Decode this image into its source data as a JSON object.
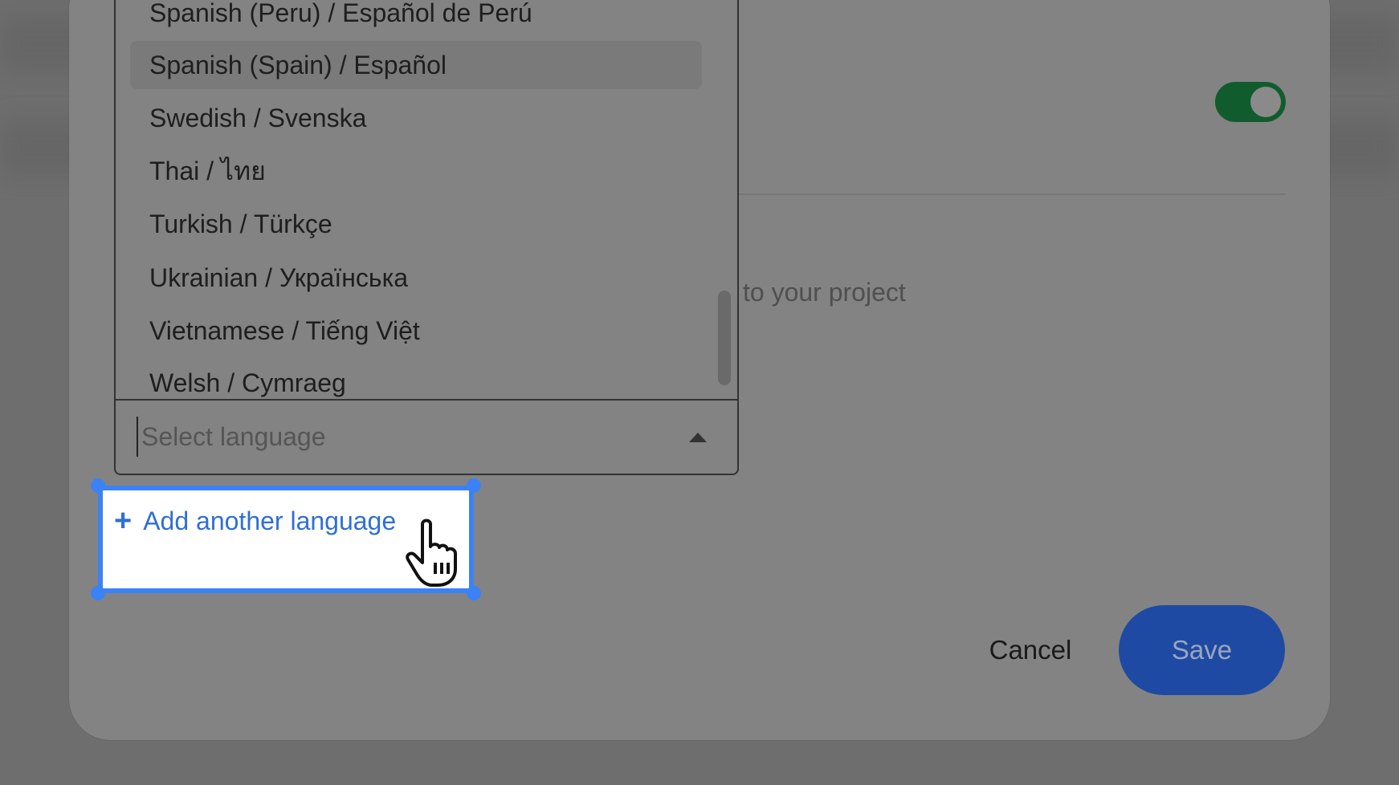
{
  "dropdown": {
    "options": [
      "Spanish (Peru) / Español de Perú",
      "Spanish (Spain) / Español",
      "Swedish / Svenska",
      "Thai / ไทย",
      "Turkish / Türkçe",
      "Ukrainian / Українська",
      "Vietnamese / Tiếng Việt",
      "Welsh / Cymraeg"
    ],
    "highlighted_option": "Spanish (Spain) / Español",
    "placeholder": "Select language"
  },
  "add_language": {
    "label": "Add another language",
    "icon": "plus-icon"
  },
  "help_text": "to your project",
  "toggle": {
    "state": "on"
  },
  "footer": {
    "cancel_label": "Cancel",
    "save_label": "Save"
  },
  "colors": {
    "accent": "#3b82f6",
    "link": "#2f6fd6",
    "toggle_on": "#115c2d",
    "save_bg": "#1e4aa3"
  }
}
